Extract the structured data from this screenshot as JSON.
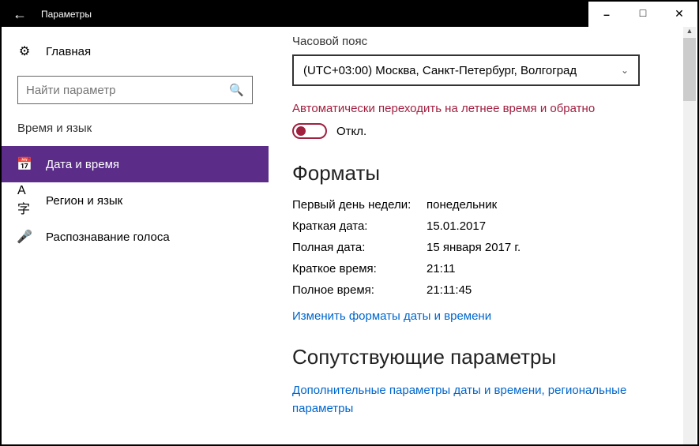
{
  "titlebar": {
    "title": "Параметры"
  },
  "sidebar": {
    "home": "Главная",
    "search_placeholder": "Найти параметр",
    "category": "Время и язык",
    "items": [
      {
        "label": "Дата и время"
      },
      {
        "label": "Регион и язык"
      },
      {
        "label": "Распознавание голоса"
      }
    ]
  },
  "main": {
    "tz_label": "Часовой пояс",
    "tz_value": "(UTC+03:00) Москва, Санкт-Петербург, Волгоград",
    "dst_label": "Автоматически переходить на летнее время и обратно",
    "toggle_state": "Откл.",
    "formats_heading": "Форматы",
    "rows": [
      {
        "k": "Первый день недели:",
        "v": "понедельник"
      },
      {
        "k": "Краткая дата:",
        "v": "15.01.2017"
      },
      {
        "k": "Полная дата:",
        "v": "15 января 2017 г."
      },
      {
        "k": "Краткое время:",
        "v": "21:11"
      },
      {
        "k": "Полное время:",
        "v": "21:11:45"
      }
    ],
    "change_formats_link": "Изменить форматы даты и времени",
    "related_heading": "Сопутствующие параметры",
    "related_link": "Дополнительные параметры даты и времени, региональные параметры"
  }
}
